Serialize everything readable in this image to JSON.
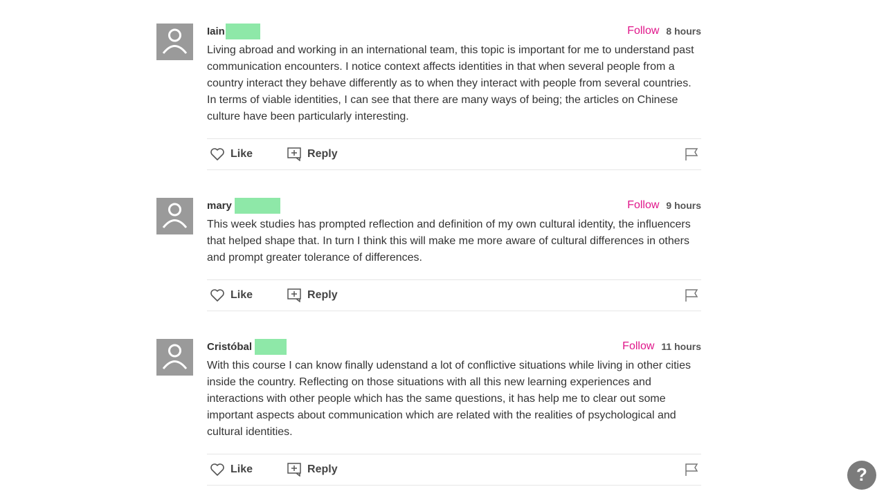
{
  "comments": [
    {
      "author": "Iain",
      "follow_label": "Follow",
      "time": "8 hours",
      "text": "Living abroad and working in an international team, this topic is important for me to understand past communication encounters. I notice context affects identities in that when several people from a country interact they behave differently as to when they interact with people from several countries. In terms of viable identities, I can see that there are many ways of being; the articles on Chinese culture have been particularly interesting.",
      "like_label": "Like",
      "reply_label": "Reply"
    },
    {
      "author": "mary",
      "follow_label": "Follow",
      "time": "9 hours",
      "text": "This week studies has prompted reflection and definition of my own cultural identity, the influencers that helped shape that. In turn I think this will make me more aware of cultural differences in others and prompt greater tolerance of differences.",
      "like_label": "Like",
      "reply_label": "Reply"
    },
    {
      "author": "Cristóbal",
      "follow_label": "Follow",
      "time": "11 hours",
      "text": "With this course I can know finally udenstand a lot of conflictive situations while living in other cities inside the country. Reflecting on those situations with all this new learning experiences and interactions with other people which has the same questions, it has help me to clear out some important aspects about communication which are related with the realities of psychological and cultural identities.",
      "like_label": "Like",
      "reply_label": "Reply"
    }
  ],
  "help_label": "?",
  "colors": {
    "accent": "#e0168a",
    "redaction": "#8ee8a8",
    "avatar": "#9a9a9a"
  }
}
